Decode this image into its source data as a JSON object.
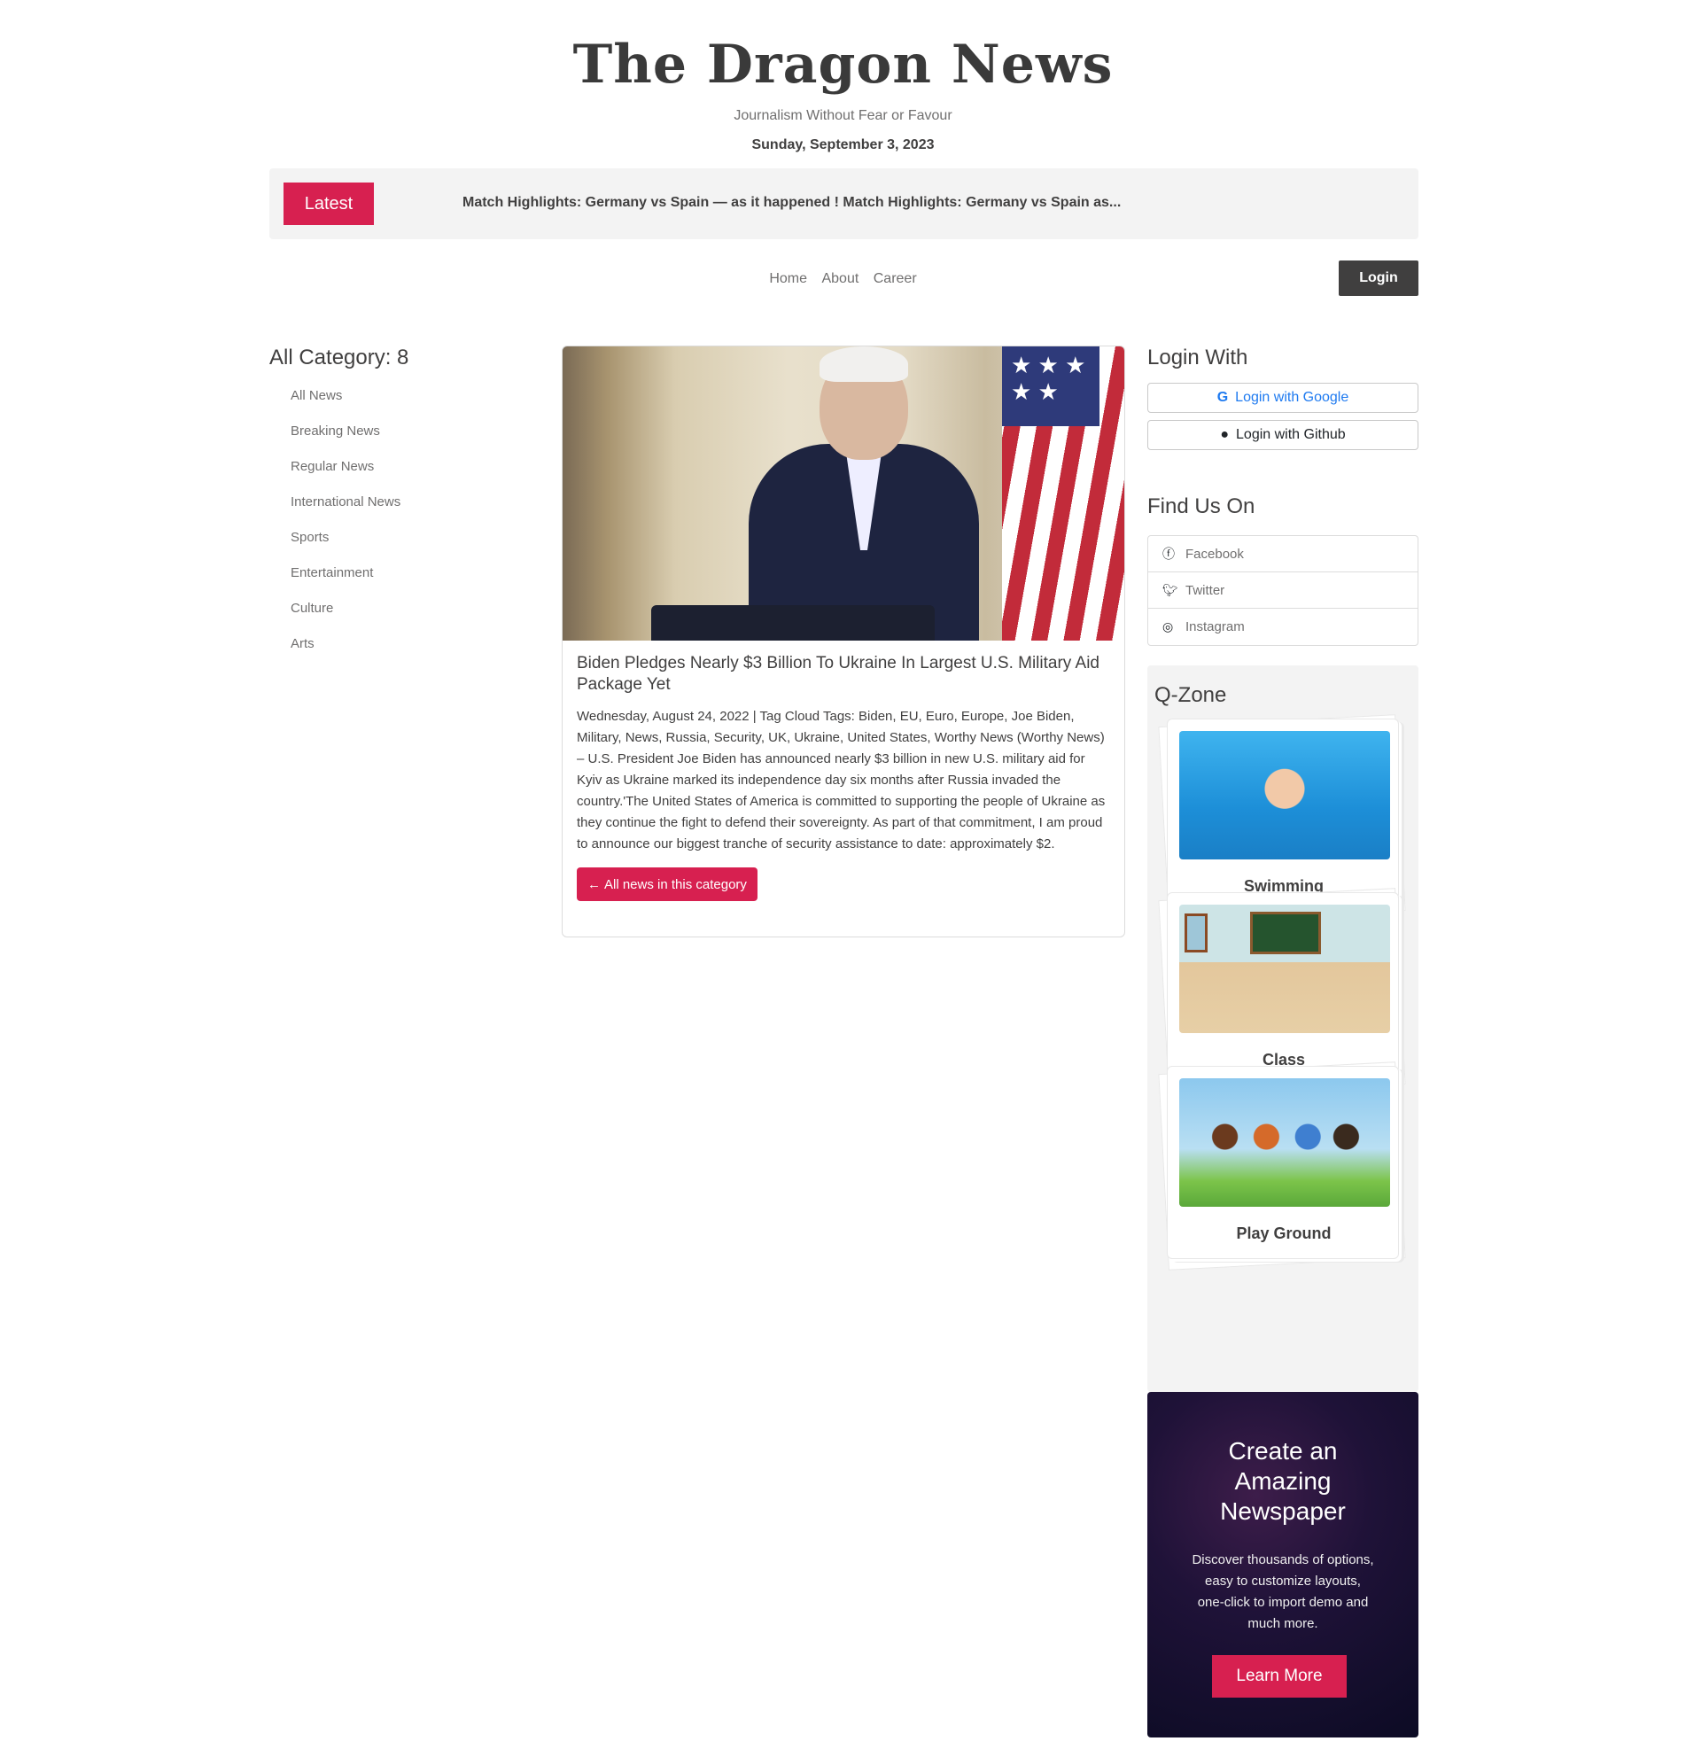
{
  "header": {
    "logo": "The Dragon News",
    "tagline": "Journalism Without Fear or Favour",
    "date": "Sunday, September 3, 2023"
  },
  "latest": {
    "button": "Latest",
    "ticker": "Match Highlights: Germany vs Spain — as it happened ! Match Highlights: Germany vs Spain as..."
  },
  "nav": {
    "items": [
      "Home",
      "About",
      "Career"
    ],
    "login": "Login"
  },
  "categories": {
    "title": "All Category: 8",
    "items": [
      "All News",
      "Breaking News",
      "Regular News",
      "International News",
      "Sports",
      "Entertainment",
      "Culture",
      "Arts"
    ]
  },
  "news": {
    "title": "Biden Pledges Nearly $3 Billion To Ukraine In Largest U.S. Military Aid Package Yet",
    "body": "Wednesday, August 24, 2022 | Tag Cloud Tags: Biden, EU, Euro, Europe, Joe Biden, Military, News, Russia, Security, UK, Ukraine, United States, Worthy News (Worthy News) – U.S. President Joe Biden has announced nearly $3 billion in new U.S. military aid for Kyiv as Ukraine marked its independence day six months after Russia invaded the country.'The United States of America is committed to supporting the people of Ukraine as they continue the fight to defend their sovereignty. As part of that commitment, I am proud to announce our biggest tranche of security assistance to date: approximately $2.",
    "button": "All news in this category",
    "flag_stars": "★ ★ ★\n★ ★"
  },
  "login_with": {
    "title": "Login With",
    "google": "Login with Google",
    "github": "Login with Github"
  },
  "find_us": {
    "title": "Find Us On",
    "items": [
      {
        "label": "Facebook",
        "icon": "facebook-icon"
      },
      {
        "label": "Twitter",
        "icon": "twitter-icon"
      },
      {
        "label": "Instagram",
        "icon": "instagram-icon"
      }
    ]
  },
  "qzone": {
    "title": "Q-Zone",
    "cards": [
      "Swimming",
      "Class",
      "Play Ground"
    ]
  },
  "promo": {
    "title": "Create an Amazing Newspaper",
    "text": "Discover thousands of options, easy to customize layouts, one-click to import demo and much more.",
    "button": "Learn More"
  },
  "colors": {
    "accent": "#d72050",
    "dark": "#403f3f",
    "muted": "#706f6f"
  }
}
